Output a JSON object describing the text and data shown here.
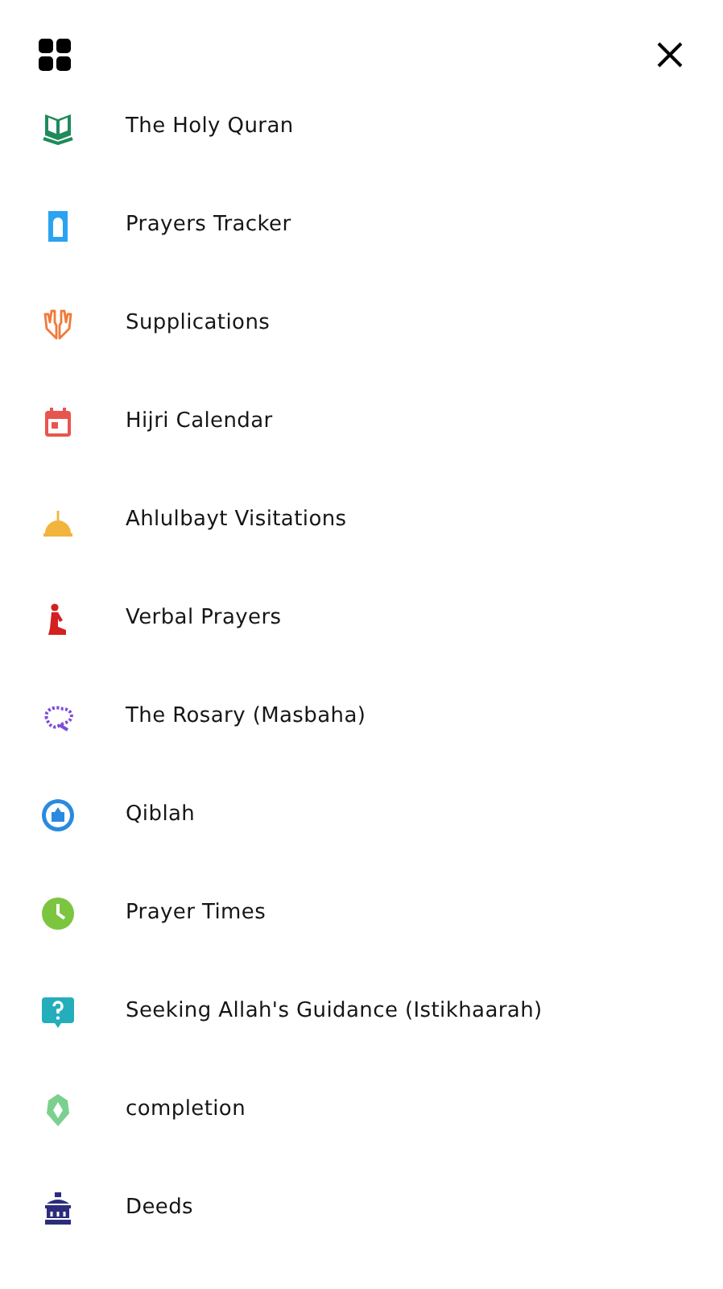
{
  "menu": {
    "items": [
      {
        "kind": "quran",
        "label": "The Holy Quran"
      },
      {
        "kind": "mat",
        "label": "Prayers Tracker"
      },
      {
        "kind": "hands",
        "label": "Supplications"
      },
      {
        "kind": "calendar",
        "label": "Hijri Calendar"
      },
      {
        "kind": "dome",
        "label": "Ahlulbayt Visitations"
      },
      {
        "kind": "kneeling",
        "label": "Verbal Prayers"
      },
      {
        "kind": "rosary",
        "label": "The Rosary (Masbaha)"
      },
      {
        "kind": "qibla",
        "label": "Qiblah"
      },
      {
        "kind": "clock",
        "label": "Prayer Times"
      },
      {
        "kind": "question",
        "label": "Seeking Allah's Guidance (Istikhaarah)"
      },
      {
        "kind": "completion",
        "label": "completion"
      },
      {
        "kind": "lantern",
        "label": "Deeds"
      }
    ]
  }
}
